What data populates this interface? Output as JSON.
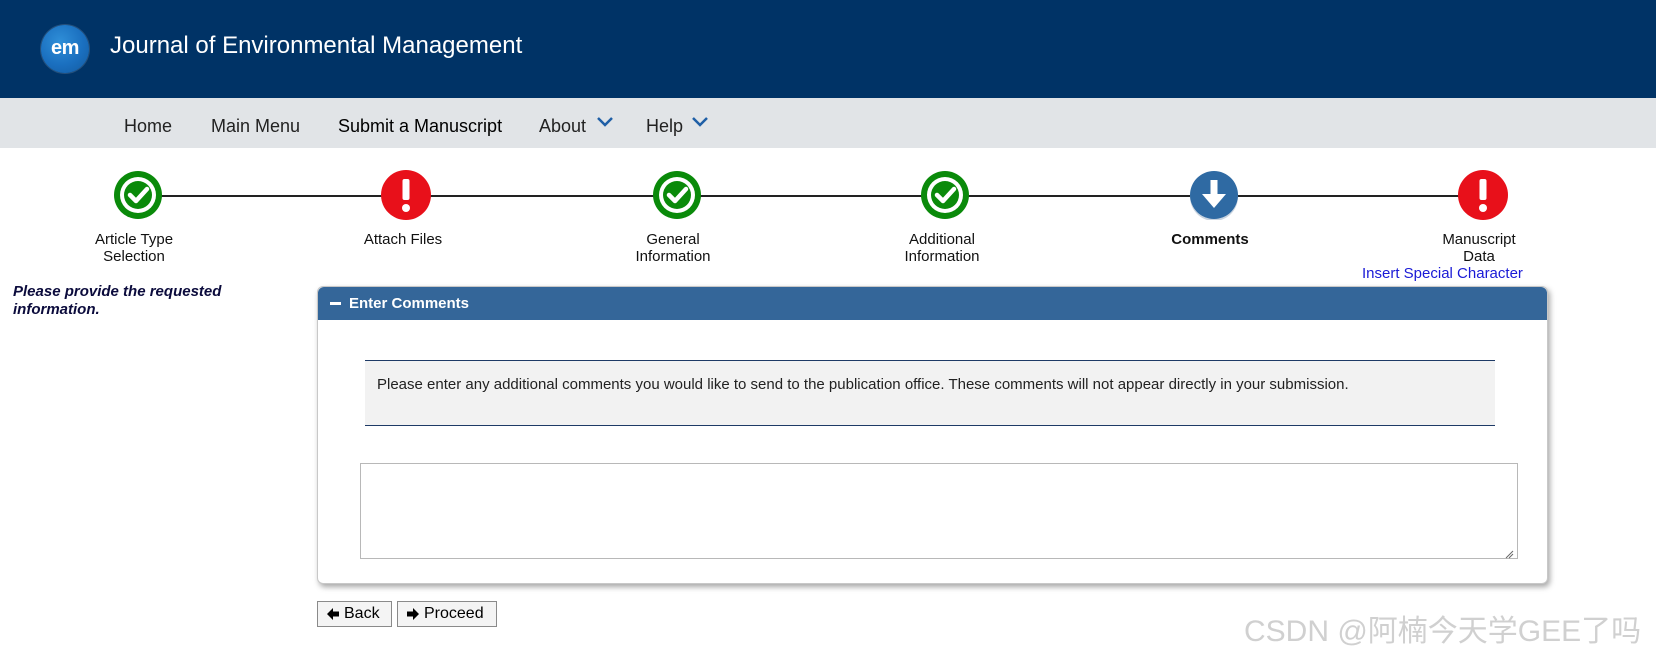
{
  "header": {
    "logo_text": "em",
    "journal_title": "Journal of Environmental Management",
    "bg_color": "#003366"
  },
  "nav": {
    "items": [
      {
        "label": "Home"
      },
      {
        "label": "Main Menu"
      },
      {
        "label": "Submit a Manuscript"
      },
      {
        "label": "About",
        "has_dropdown": true
      },
      {
        "label": "Help",
        "has_dropdown": true
      }
    ]
  },
  "steps": [
    {
      "label_line1": "Article Type",
      "label_line2": "Selection",
      "status": "complete",
      "icon": "check-circle-icon"
    },
    {
      "label_line1": "Attach Files",
      "label_line2": "",
      "status": "error",
      "icon": "exclamation-circle-icon"
    },
    {
      "label_line1": "General",
      "label_line2": "Information",
      "status": "complete",
      "icon": "check-circle-icon"
    },
    {
      "label_line1": "Additional",
      "label_line2": "Information",
      "status": "complete",
      "icon": "check-circle-icon"
    },
    {
      "label_line1": "Comments",
      "label_line2": "",
      "status": "current",
      "icon": "arrow-down-circle-icon"
    },
    {
      "label_line1": "Manuscript",
      "label_line2": "Data",
      "status": "error",
      "icon": "exclamation-circle-icon"
    }
  ],
  "colors": {
    "complete": "#0a8a0a",
    "error": "#e8101a",
    "current": "#2f6aa3",
    "panel_header": "#346699"
  },
  "special_character_link": "Insert Special Character",
  "instruction": "Please provide the requested information.",
  "panel": {
    "title": "Enter Comments",
    "notice": "Please enter any additional comments you would like to send to the publication office. These comments will not appear directly in your submission.",
    "comments_value": ""
  },
  "buttons": {
    "back": "Back",
    "proceed": "Proceed"
  },
  "watermark": "CSDN @阿楠今天学GEE了吗"
}
